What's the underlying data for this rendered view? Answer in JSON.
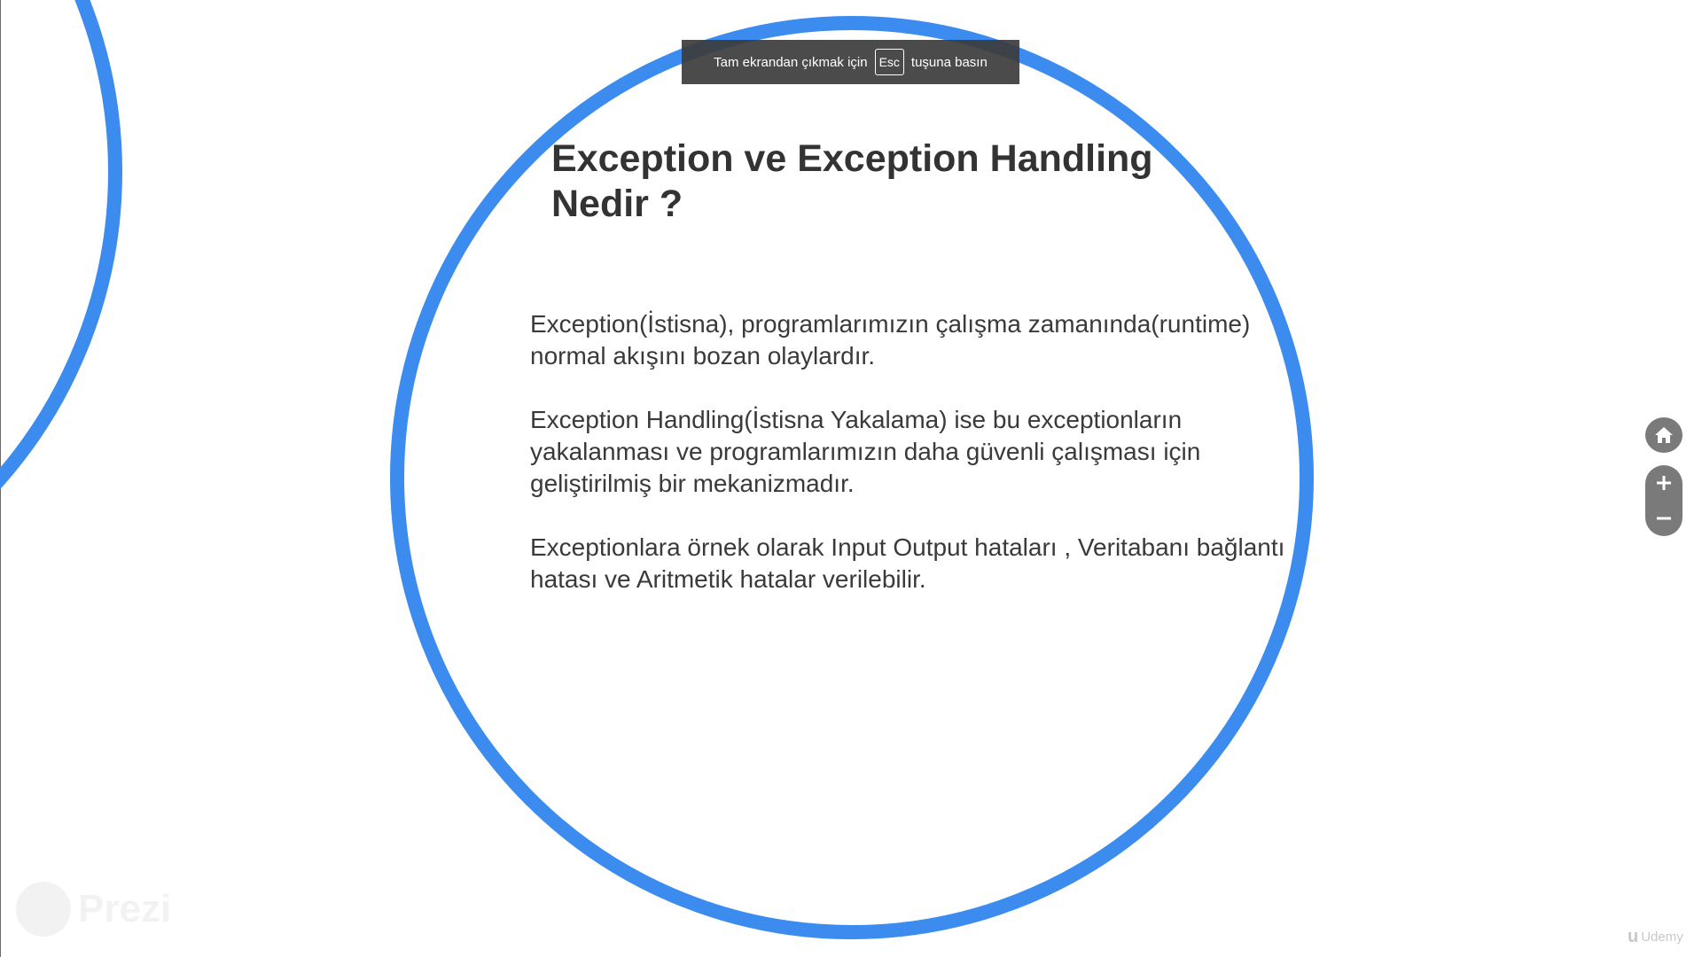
{
  "fullscreen_notice": {
    "before": "Tam ekrandan çıkmak için",
    "key": "Esc",
    "after": "tuşuna basın"
  },
  "slide": {
    "title": "Exception ve Exception Handling Nedir ?",
    "paragraphs": [
      "Exception(İstisna), programlarımızın çalışma zamanında(runtime) normal akışını bozan olaylardır.",
      "Exception Handling(İstisna Yakalama) ise bu exceptionların yakalanması ve programlarımızın daha güvenli çalışması için geliştirilmiş bir mekanizmadır.",
      "Exceptionlara örnek olarak Input Output hataları , Veritabanı bağlantı hatası ve Aritmetik hatalar verilebilir."
    ]
  },
  "controls": {
    "home_icon": "home-icon",
    "zoom_in_icon": "plus-icon",
    "zoom_out_icon": "minus-icon"
  },
  "watermarks": {
    "presenter_logo_text": "Prezi",
    "udemy_text": "Udemy"
  },
  "colors": {
    "circle_accent": "#3c8cf0",
    "title_text": "#333333",
    "body_text": "#3a3a3a",
    "control_bg": "#7a7a7a",
    "banner_bg": "#3c3c3c"
  }
}
